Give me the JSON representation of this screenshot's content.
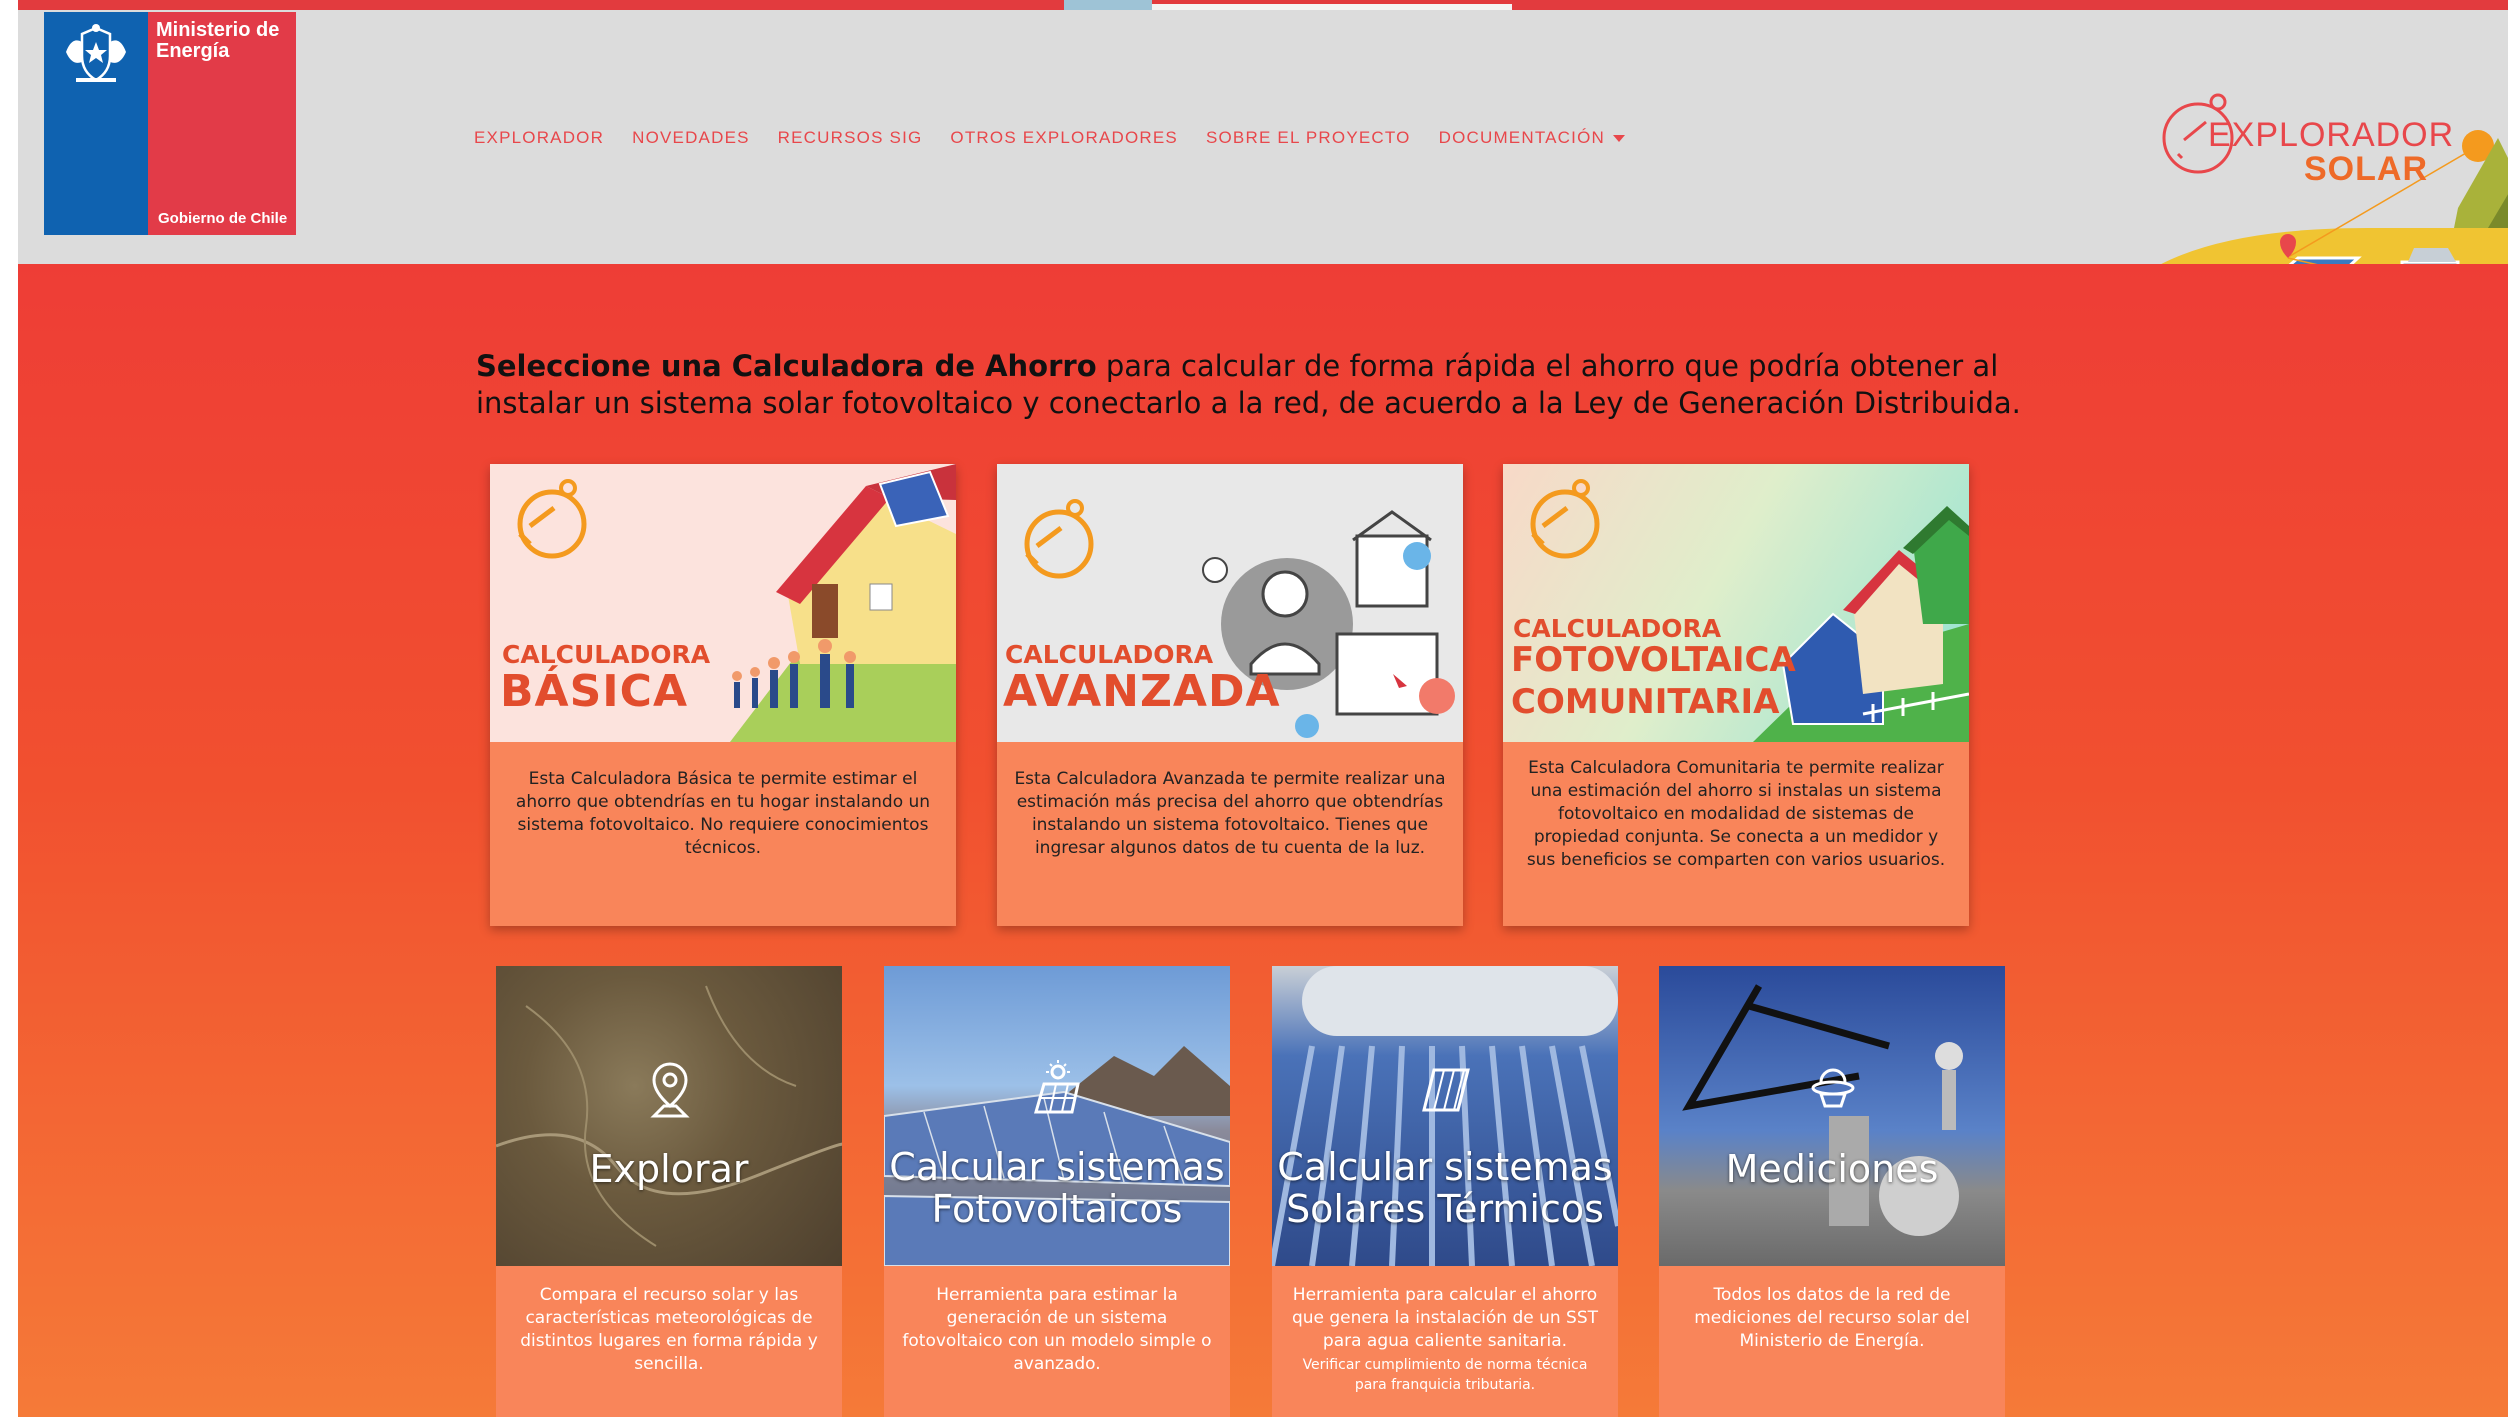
{
  "header": {
    "logo": {
      "line1": "Ministerio de Energía",
      "line2": "Gobierno de Chile"
    },
    "nav": [
      {
        "label": "EXPLORADOR"
      },
      {
        "label": "NOVEDADES"
      },
      {
        "label": "RECURSOS SIG"
      },
      {
        "label": "OTROS EXPLORADORES"
      },
      {
        "label": "SOBRE EL PROYECTO"
      },
      {
        "label": "DOCUMENTACIÓN",
        "has_dropdown": true
      }
    ],
    "brand": {
      "word1": "EXPLORADOR",
      "word2": "SOLAR"
    }
  },
  "intro": {
    "bold": "Seleccione una Calculadora de Ahorro",
    "rest": " para calcular de forma rápida el ahorro que podría obtener al instalar un sistema solar fotovoltaico y conectarlo a la red, de acuerdo a la Ley de Generación Distribuida."
  },
  "calculators": [
    {
      "label_small": "CALCULADORA",
      "label_big": "BÁSICA",
      "desc": "Esta Calculadora Básica te permite estimar el ahorro que obtendrías en tu hogar instalando un sistema fotovoltaico. No requiere conocimientos técnicos."
    },
    {
      "label_small": "CALCULADORA",
      "label_big": "AVANZADA",
      "desc": "Esta Calculadora Avanzada te permite realizar una estimación más precisa del ahorro que obtendrías instalando un sistema fotovoltaico. Tienes que ingresar algunos datos de tu cuenta de la luz."
    },
    {
      "label_small": "CALCULADORA",
      "label_mid": "FOTOVOLTAICA",
      "label_big": "COMUNITARIA",
      "desc": "Esta Calculadora Comunitaria te permite realizar una estimación del ahorro si instalas un sistema fotovoltaico en modalidad de sistemas de propiedad conjunta. Se conecta a un medidor y sus beneficios se comparten con varios usuarios."
    }
  ],
  "tools": [
    {
      "title": "Explorar",
      "desc": "Compara el recurso solar y las características meteorológicas de distintos lugares en forma rápida y sencilla."
    },
    {
      "title1": "Calcular sistemas",
      "title2": "Fotovoltaicos",
      "desc": "Herramienta para estimar la generación de un sistema fotovoltaico con un modelo simple o avanzado."
    },
    {
      "title1": "Calcular sistemas",
      "title2": "Solares Térmicos",
      "desc": "Herramienta para calcular el ahorro que genera la instalación de un SST para agua caliente sanitaria.",
      "desc_small": "Verificar cumplimiento de norma técnica para franquicia tributaria."
    },
    {
      "title": "Mediciones",
      "desc": "Todos los datos de la red de mediciones del recurso solar del Ministerio de Energía."
    }
  ]
}
